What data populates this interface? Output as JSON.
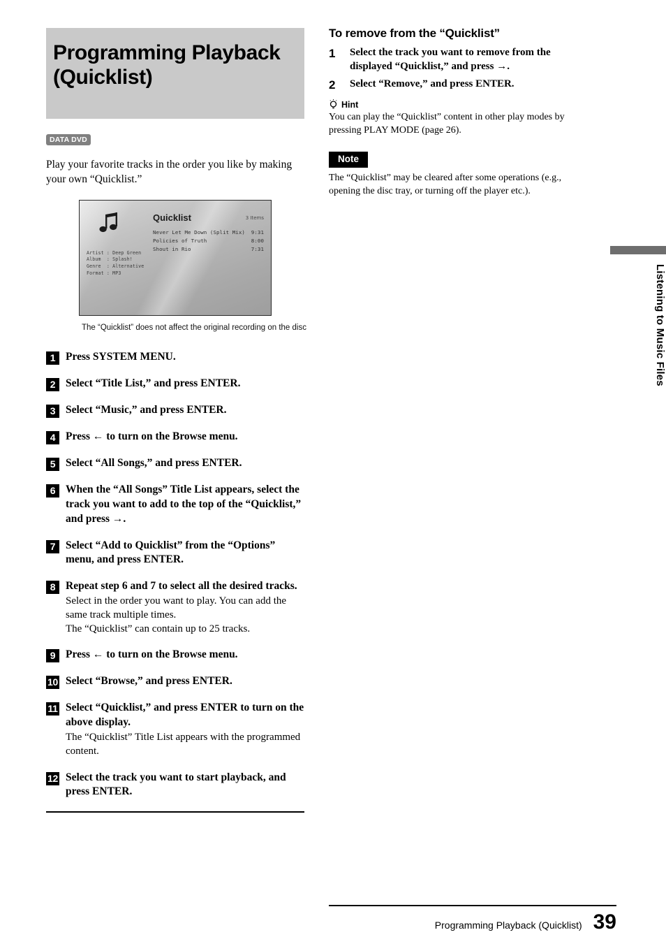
{
  "page": {
    "title": "Programming Playback (Quicklist)",
    "page_number": "39",
    "side_tab_label": "Listening to Music Files"
  },
  "left": {
    "heading": "Programming Playback (Quicklist)",
    "media_badge": "DATA DVD",
    "intro": "Play your favorite tracks in the order you like by making your own “Quicklist.”",
    "screen": {
      "note_icon": "music-note-icon",
      "title": "Quicklist",
      "item_count": "3 Items",
      "tracks": [
        {
          "name": "Never Let Me Down (Split Mix)",
          "time": "9:31"
        },
        {
          "name": "Policies of Truth",
          "time": "8:00"
        },
        {
          "name": "Shout in Rio",
          "time": "7:31"
        }
      ],
      "meta": [
        "Artist : Deep Green",
        "Album  : Splash!",
        "Genre  : Alternative",
        "Format : MP3"
      ]
    },
    "caption": "The “Quicklist” does not affect the original recording on the disc",
    "steps": [
      {
        "num": "1",
        "head": "Press SYSTEM MENU.",
        "sub": []
      },
      {
        "num": "2",
        "head": "Select “Title List,” and press ENTER.",
        "sub": []
      },
      {
        "num": "3",
        "head": "Select “Music,” and press ENTER.",
        "sub": []
      },
      {
        "num": "4",
        "head": "Press ← to turn on the Browse menu.",
        "sub": []
      },
      {
        "num": "5",
        "head": "Select “All Songs,” and press ENTER.",
        "sub": []
      },
      {
        "num": "6",
        "head": "When the “All Songs” Title List appears, select the track you want to add to the top of the “Quicklist,” and press →.",
        "sub": []
      },
      {
        "num": "7",
        "head": "Select “Add to Quicklist” from the “Options” menu, and press ENTER.",
        "sub": []
      },
      {
        "num": "8",
        "head": "Repeat step 6 and 7 to select all the desired tracks.",
        "sub": [
          "Select in the order you want to play. You can add the same track multiple times.",
          "The “Quicklist” can contain up to 25 tracks."
        ]
      },
      {
        "num": "9",
        "head": "Press ← to turn on the Browse menu.",
        "sub": []
      },
      {
        "num": "10",
        "head": "Select “Browse,” and press ENTER.",
        "sub": []
      },
      {
        "num": "11",
        "head": "Select “Quicklist,” and press ENTER to turn on the above display.",
        "sub": [
          "The “Quicklist” Title List appears with the programmed content."
        ]
      },
      {
        "num": "12",
        "head": "Select the track you want to start playback, and press ENTER.",
        "sub": []
      }
    ]
  },
  "right": {
    "sub_heading": "To remove from the “Quicklist”",
    "steps": [
      {
        "num": "1",
        "text": "Select the track you want to remove from the displayed “Quicklist,” and press →."
      },
      {
        "num": "2",
        "text": "Select “Remove,” and press ENTER."
      }
    ],
    "hint": {
      "icon": "lightbulb-icon",
      "label": "Hint",
      "body": "You can play the “Quicklist” content in other play modes by pressing PLAY MODE (page 26)."
    },
    "note": {
      "label": "Note",
      "body": "The “Quicklist” may be cleared after some operations (e.g., opening the disc tray, or turning off the player etc.)."
    }
  },
  "footer": {
    "title": "Programming Playback (Quicklist)",
    "page": "39"
  }
}
